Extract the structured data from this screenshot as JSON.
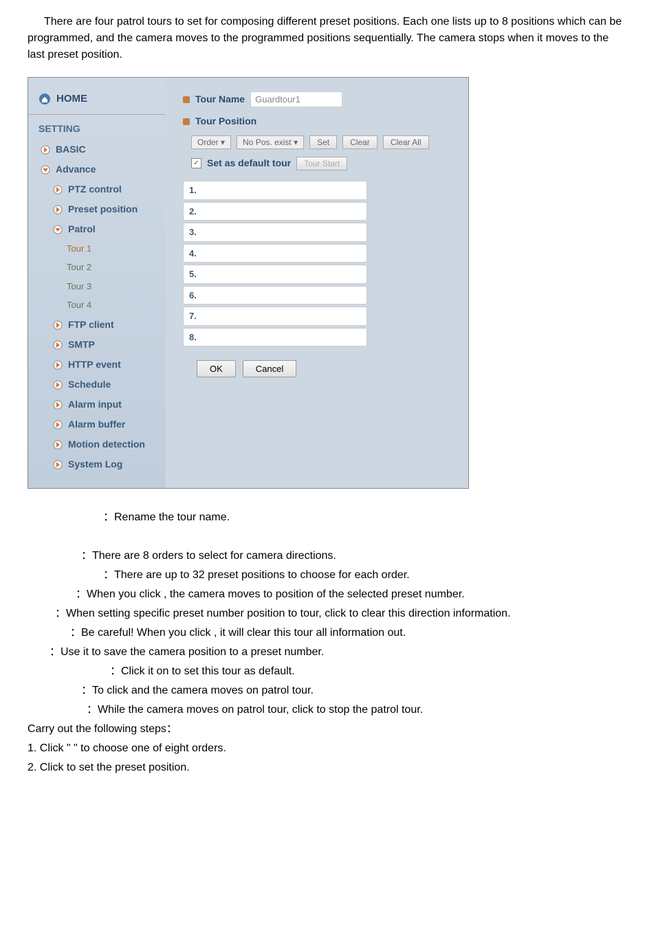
{
  "intro": "There are four patrol tours to set for composing different preset positions. Each one lists up to 8 positions which can be programmed, and the camera moves to the programmed positions sequentially. The camera stops when it moves to the last preset position.",
  "home_label": "HOME",
  "sidebar": {
    "section": "SETTING",
    "basic": "BASIC",
    "advance": "Advance",
    "ptz": "PTZ control",
    "preset": "Preset position",
    "patrol": "Patrol",
    "tours": [
      "Tour 1",
      "Tour 2",
      "Tour 3",
      "Tour 4"
    ],
    "ftp": "FTP client",
    "smtp": "SMTP",
    "http": "HTTP event",
    "schedule": "Schedule",
    "alarm_input": "Alarm input",
    "alarm_buffer": "Alarm buffer",
    "motion": "Motion detection",
    "syslog": "System Log"
  },
  "main": {
    "tour_name_label": "Tour Name",
    "tour_name_value": "Guardtour1",
    "tour_position_label": "Tour Position",
    "order_btn": "Order",
    "nopos_btn": "No Pos. exist",
    "set_btn": "Set",
    "clear_btn": "Clear",
    "clearall_btn": "Clear All",
    "default_tour_label": "Set as default tour",
    "tour_start_btn": "Tour Start",
    "positions": [
      "1.",
      "2.",
      "3.",
      "4.",
      "5.",
      "6.",
      "7.",
      "8."
    ],
    "ok_btn": "OK",
    "cancel_btn": "Cancel"
  },
  "descriptions": {
    "rename": "：Rename the tour name.",
    "order": "：There are 8 orders to select for camera directions.",
    "preset_pos": "：There are up to 32 preset positions to choose for each order.",
    "when_click": "：When you click         , the camera moves to position of the selected preset number.",
    "when_setting": "：When setting specific preset number position to tour, click          to clear this direction information.",
    "be_careful": "：Be careful! When you click            , it will clear this tour all information out.",
    "save": "：Use it to save the camera position to a preset number.",
    "default": "：Click it on to set this tour as default.",
    "to_click": "：To click                 and the camera moves on patrol tour.",
    "while": "：While the camera moves on patrol tour, click              to stop the patrol tour.",
    "carry": "Carry out the following steps：",
    "step1": "1.  Click \"        \" to choose one of eight orders.",
    "step2": "2.  Click                 to set the preset position."
  }
}
